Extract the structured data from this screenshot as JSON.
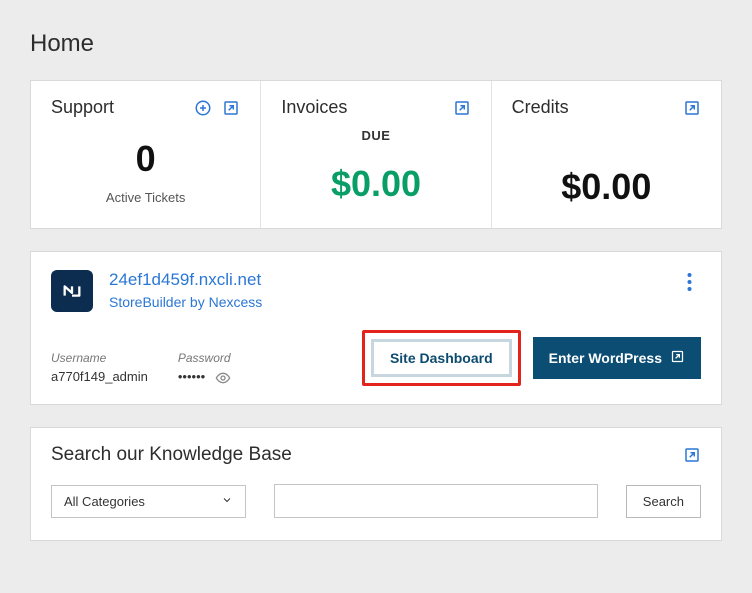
{
  "page_title": "Home",
  "stats": {
    "support": {
      "title": "Support",
      "value": "0",
      "foot": "Active Tickets"
    },
    "invoices": {
      "title": "Invoices",
      "sub": "DUE",
      "value": "$0.00"
    },
    "credits": {
      "title": "Credits",
      "value": "$0.00"
    }
  },
  "site": {
    "url": "24ef1d459f.nxcli.net",
    "plan": "StoreBuilder by Nexcess",
    "username_label": "Username",
    "username": "a770f149_admin",
    "password_label": "Password",
    "password_masked": "••••••",
    "dashboard_label": "Site Dashboard",
    "wordpress_label": "Enter WordPress"
  },
  "kb": {
    "title": "Search our Knowledge Base",
    "category_selected": "All Categories",
    "search_label": "Search"
  }
}
